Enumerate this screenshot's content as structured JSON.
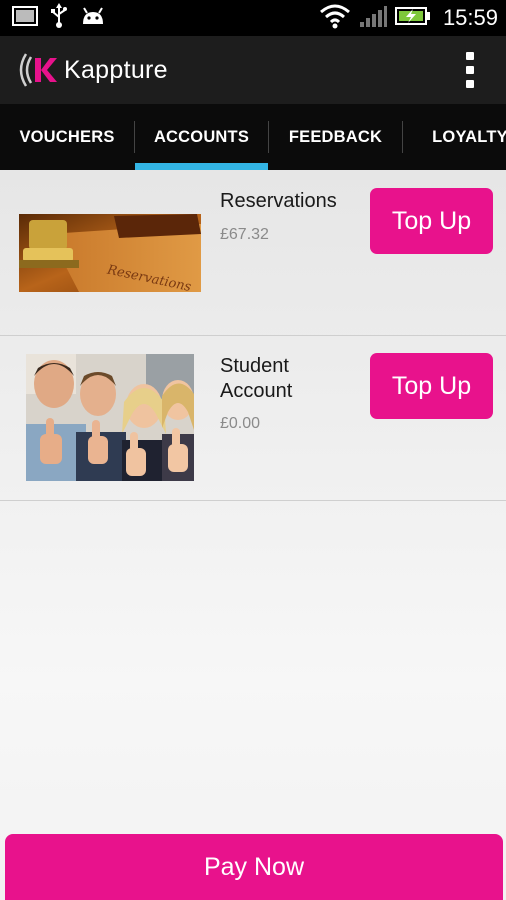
{
  "status_bar": {
    "time": "15:59",
    "icons": [
      "gallery-icon",
      "usb-icon",
      "android-icon",
      "wifi-icon",
      "signal-icon",
      "battery-charging-icon"
    ]
  },
  "app": {
    "title": "Kappture",
    "logo_letter": "K"
  },
  "tabs": [
    {
      "label": "VOUCHERS",
      "selected": false
    },
    {
      "label": "ACCOUNTS",
      "selected": true
    },
    {
      "label": "FEEDBACK",
      "selected": false
    },
    {
      "label": "LOYALTY",
      "selected": false
    }
  ],
  "accounts": [
    {
      "name": "Reservations",
      "balance": "£67.32",
      "button": "Top Up",
      "image_text": "Reservations"
    },
    {
      "name": "Student\nAccount",
      "balance": "£0.00",
      "button": "Top Up"
    }
  ],
  "footer": {
    "pay_label": "Pay Now"
  },
  "colors": {
    "accent": "#e8128c",
    "tab_indicator": "#33b5e5",
    "action_bar": "#1d1d1d",
    "tab_bar": "#0b0b0b"
  }
}
